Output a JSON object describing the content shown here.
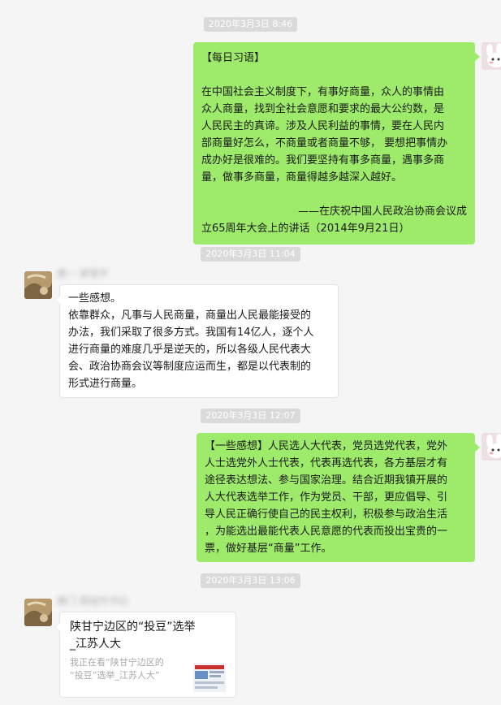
{
  "colors": {
    "background": "#f5f5f5",
    "my_bubble": "#9eea6a",
    "their_bubble": "#ffffff",
    "timestamp_bg": "#dadada"
  },
  "timestamps": [
    "2020年3月3日 8:46",
    "2020年3月3日 11:04",
    "2020年3月3日 12:07",
    "2020年3月3日 13:06"
  ],
  "messages": [
    {
      "side": "right",
      "lines": [
        "【每日习语】",
        "",
        "在中国社会主义制度下，有事好商量，众人的事情由",
        "众人商量，找到全社会意愿和要求的最大公约数，是",
        "人民民主的真谛。涉及人民利益的事情，要在人民内",
        "部商量好怎么，不商量或者商量不够， 要想把事情办",
        "成办好是很难的。我们要坚持有事多商量，遇事多商",
        "量，做事多商量，商量得越多越深入越好。",
        "",
        "——在庆祝中国人民政治协商会议成",
        "立65周年大会上的讲话（2014年9月21日）"
      ]
    },
    {
      "side": "left",
      "sender": "唐一 郭雪平",
      "lines": [
        "一些感想。",
        "依靠群众，凡事与人民商量，商量出人民最能接受的",
        "办法，我们采取了很多方式。我国有14亿人，逐个人",
        "进行商量的难度几乎是逆天的，所以各级人民代表大",
        "会、政治协商会议等制度应运而生，都是以代表制的",
        "形式进行商量。"
      ]
    },
    {
      "side": "right",
      "lines": [
        "【一些感想】人民选人大代表，党员选党代表，党外",
        "人士选党外人士代表，代表再选代表，各方基层才有",
        "途径表达想法、参与国家治理。结合近期我镇开展的",
        "人大代表选举工作，作为党员、干部，更应倡导、引",
        "导人民正确行使自己的民主权利，积极参与政治生活",
        "，为能选出最能代表人民意愿的代表而投出宝贵的一",
        "票，做好基层“商量”工作。"
      ]
    },
    {
      "side": "left",
      "sender": "唐门 郭组作书记",
      "card": {
        "title_lines": [
          "陕甘宁边区的“投豆”选举",
          "_江苏人大"
        ],
        "desc_lines": [
          "我正在看“陕甘宁边区的",
          "“投豆”选举_江苏人大”"
        ]
      }
    }
  ]
}
